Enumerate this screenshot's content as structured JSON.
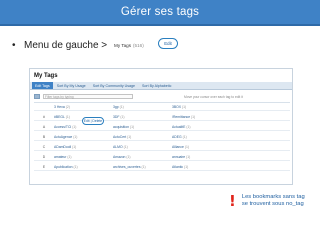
{
  "slide": {
    "title": "Gérer ses tags",
    "bullet": "•",
    "bullet_text": "Menu de gauche >"
  },
  "mini_menu": {
    "tab_label": "My Tags",
    "tab_count": "(516)",
    "edit_label": "Edit"
  },
  "screenshot": {
    "title": "My Tags",
    "tabs": [
      {
        "label": "Edit Tags",
        "active": true
      },
      {
        "label": "Sort By My Usage",
        "active": false
      },
      {
        "label": "Sort By Community Usage",
        "active": false
      },
      {
        "label": "Sort By Alphabetic",
        "active": false
      }
    ],
    "filter_placeholder": "Filter tags by typing",
    "filter_note": "Move your cursor over each tag to edit it",
    "highlight_label": "Edit | Delete",
    "rows": [
      {
        "letter": "",
        "tags": [
          {
            "name": "3 Hexa",
            "count": "(2)"
          },
          {
            "name": "3gp",
            "count": "(1)"
          },
          {
            "name": "3BOX",
            "count": "(1)"
          },
          {
            "name": "",
            "count": ""
          }
        ]
      },
      {
        "letter": "#",
        "tags": [
          {
            "name": "#BEGL",
            "count": "(1)"
          },
          {
            "name": "3DF",
            "count": "(1)"
          },
          {
            "name": "/Remittance",
            "count": "(1)"
          },
          {
            "name": "",
            "count": ""
          }
        ]
      },
      {
        "letter": "A",
        "tags": [
          {
            "name": "Access/TCI",
            "count": "(1)"
          },
          {
            "name": "acquisition",
            "count": "(1)"
          },
          {
            "name": "ActualitE",
            "count": "(1)"
          },
          {
            "name": "",
            "count": ""
          }
        ]
      },
      {
        "letter": "B",
        "tags": [
          {
            "name": "ActuAgence",
            "count": "(1)"
          },
          {
            "name": "ActuCert",
            "count": "(1)"
          },
          {
            "name": "ADEG",
            "count": "(1)"
          },
          {
            "name": "",
            "count": ""
          }
        ]
      },
      {
        "letter": "C",
        "tags": [
          {
            "name": "ADamDooll",
            "count": "(1)"
          },
          {
            "name": "ALMO",
            "count": "(1)"
          },
          {
            "name": "Alliance",
            "count": "(1)"
          },
          {
            "name": "",
            "count": ""
          }
        ]
      },
      {
        "letter": "D",
        "tags": [
          {
            "name": "amateur",
            "count": "(1)"
          },
          {
            "name": "Amazon",
            "count": "(1)"
          },
          {
            "name": "annuaire",
            "count": "(1)"
          },
          {
            "name": "",
            "count": ""
          }
        ]
      },
      {
        "letter": "E",
        "tags": [
          {
            "name": "Apublication",
            "count": "(1)"
          },
          {
            "name": "archives_ouvertes",
            "count": "(1)"
          },
          {
            "name": "Atlantic",
            "count": "(1)"
          },
          {
            "name": "",
            "count": ""
          }
        ]
      }
    ]
  },
  "note": {
    "mark": "!",
    "line1": "Les bookmarks sans tag",
    "line2": "se trouvent sous no_tag"
  },
  "colors": {
    "header_blue": "#3f82c6",
    "alert_red": "#e0241b",
    "note_blue": "#1f5fa0"
  }
}
